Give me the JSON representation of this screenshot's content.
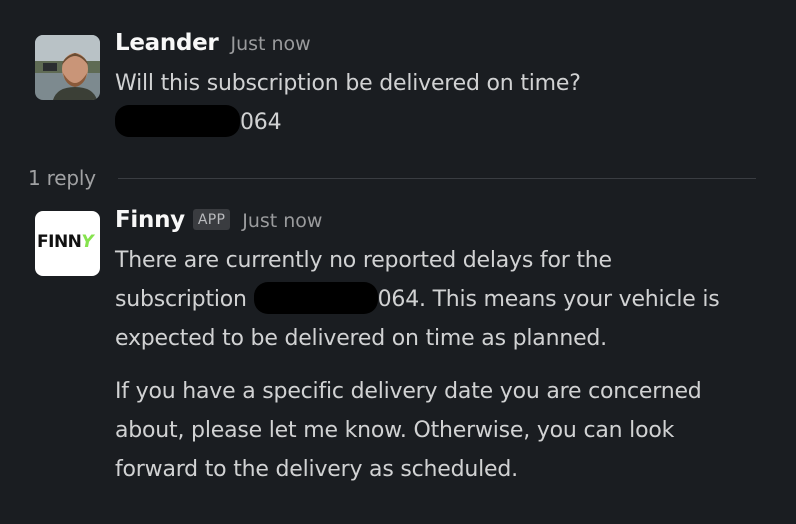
{
  "messages": [
    {
      "author": "Leander",
      "time": "Just now",
      "avatar_icon": "user-photo-avatar",
      "lines": {
        "line1": "Will this subscription be delivered on time?",
        "line2_suffix": "064"
      }
    },
    {
      "author": "Finny",
      "badge": "APP",
      "time": "Just now",
      "avatar_text": "FINN",
      "avatar_text_accent": "Y",
      "avatar_accent_color": "#86e34e",
      "para1_line1": "There are currently no reported delays for the",
      "para1_line2_prefix": "subscription",
      "para1_line2_suffix": "064. This means your vehicle is",
      "para1_line3": "expected to be delivered on time as planned.",
      "para2": "If you have a specific delivery date you are concerned about, please let me know. Otherwise, you can look forward to the delivery as scheduled."
    }
  ],
  "thread": {
    "reply_count_label": "1 reply"
  },
  "colors": {
    "background": "#1a1d21",
    "text": "#d1d2d3",
    "muted": "#9a9b9d"
  }
}
